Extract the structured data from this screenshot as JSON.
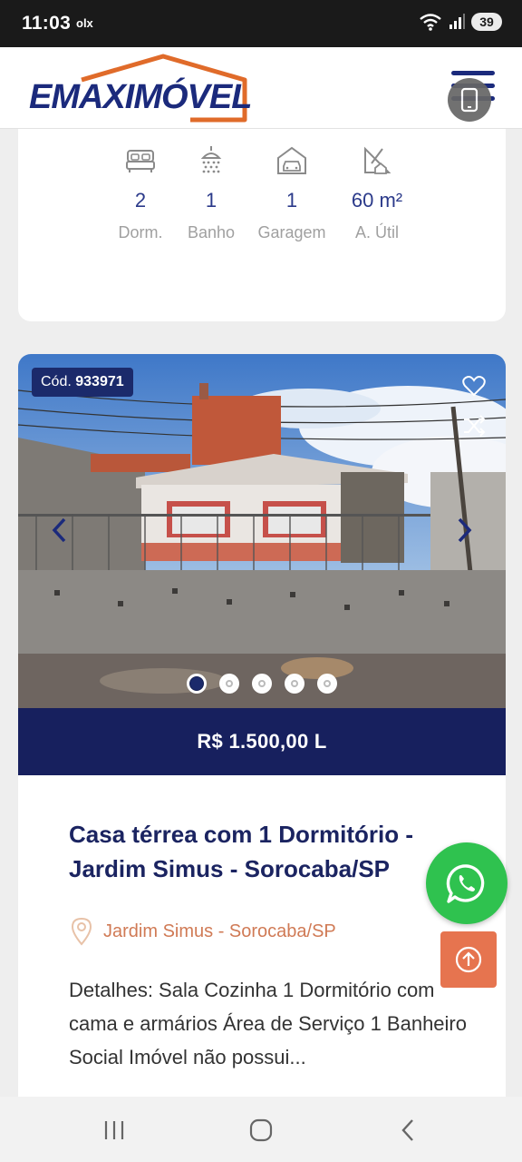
{
  "status_bar": {
    "time": "11:03",
    "app_indicator": "olx",
    "battery": "39",
    "icons": [
      "wifi-icon",
      "signal-icon",
      "battery-icon"
    ]
  },
  "header": {
    "logo_text": "EMAXIMÓVEL",
    "brand_colors": {
      "navy": "#1b2a7c",
      "orange": "#e06b2a"
    }
  },
  "specs": [
    {
      "icon": "bed-icon",
      "value": "2",
      "label": "Dorm."
    },
    {
      "icon": "shower-icon",
      "value": "1",
      "label": "Banho"
    },
    {
      "icon": "garage-icon",
      "value": "1",
      "label": "Garagem"
    },
    {
      "icon": "area-icon",
      "value": "60 m²",
      "label": "A. Útil"
    }
  ],
  "listing": {
    "code_label": "Cód.",
    "code": "933971",
    "price": "R$ 1.500,00 L",
    "title": "Casa térrea com 1 Dormitório - Jardim Simus - Sorocaba/SP",
    "location": "Jardim Simus - Sorocaba/SP",
    "description": "Detalhes: Sala Cozinha 1 Dormitório com cama e armários Área de Serviço 1 Banheiro Social Imóvel não possui...",
    "carousel_total": 5,
    "carousel_active": 1
  },
  "colors": {
    "price_bar": "#17205e",
    "whatsapp": "#2fc24f",
    "scroll_top": "#e6744f",
    "location_text": "#d07a55"
  }
}
